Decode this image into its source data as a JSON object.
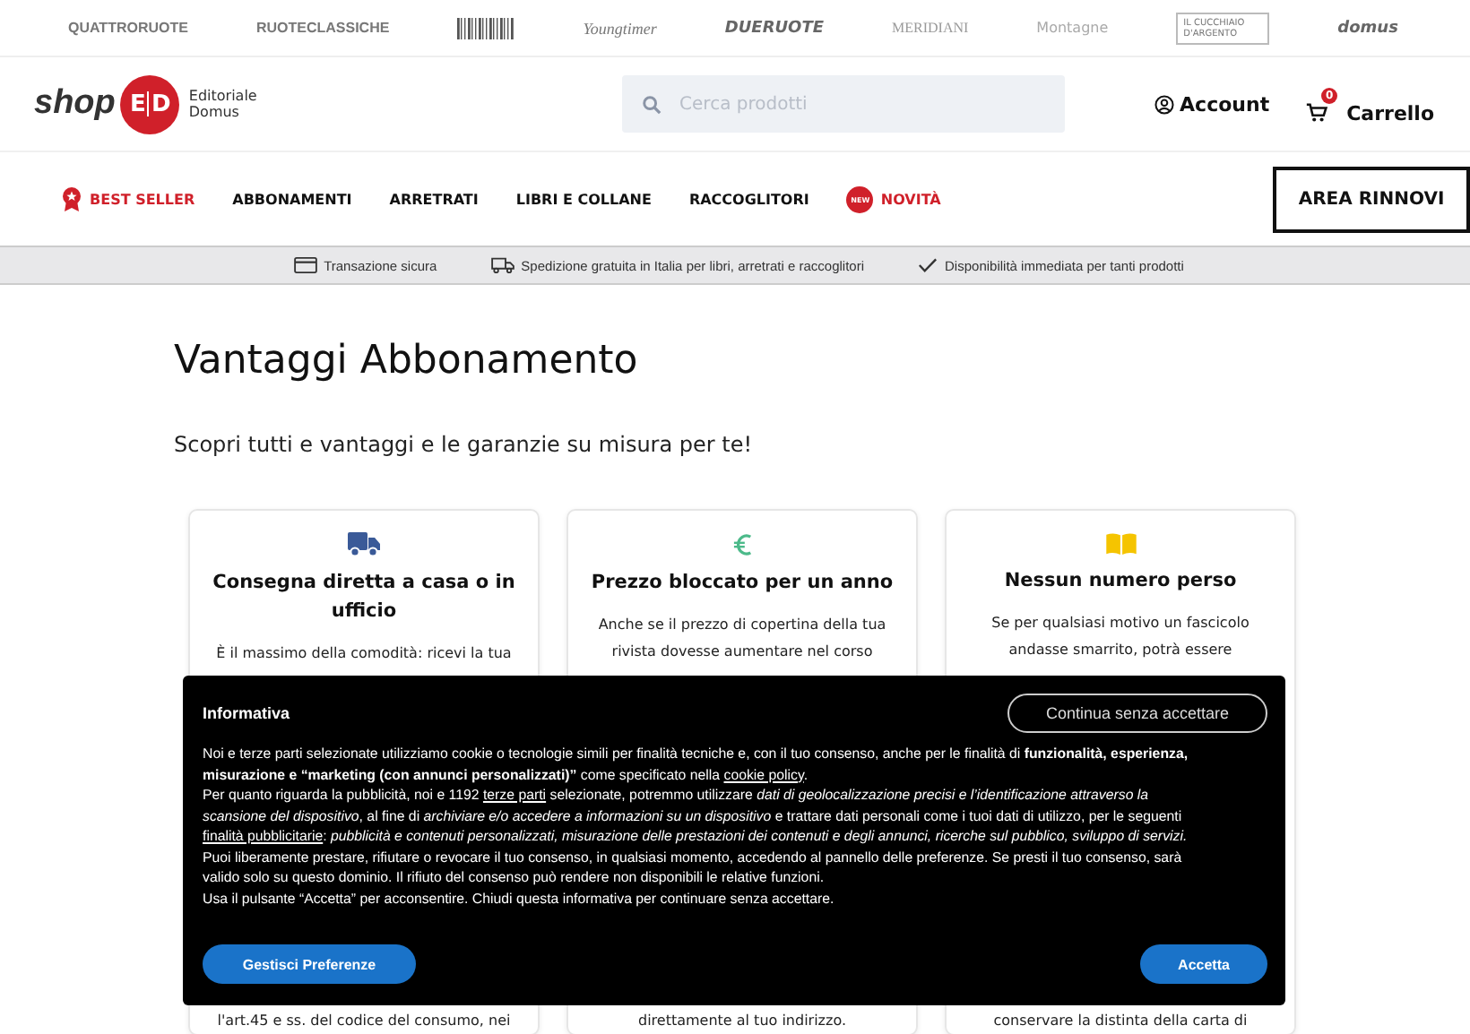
{
  "brands": [
    {
      "label": "QUATTRORUOTE",
      "kind": "caps"
    },
    {
      "label": "RUOTECLASSICHE",
      "kind": "caps"
    },
    {
      "kind": "barcode"
    },
    {
      "label": "Youngtimer",
      "kind": "script"
    },
    {
      "label": "DUERUOTE",
      "kind": "heavy"
    },
    {
      "label": "MERIDIANI",
      "kind": "serif"
    },
    {
      "label": "Montagne",
      "kind": "faded"
    },
    {
      "label": "IL CUCCHIAIO D'ARGENTO",
      "kind": "boxed"
    },
    {
      "label": "domus",
      "kind": "heavy"
    }
  ],
  "header": {
    "logo_shop": "shop",
    "logo_e": "E",
    "logo_d": "D",
    "logo_line1": "Editoriale",
    "logo_line2": "Domus",
    "search_placeholder": "Cerca prodotti",
    "account": "Account",
    "cart": "Carrello",
    "cart_count": "0"
  },
  "nav": {
    "items": [
      {
        "label": "BEST SELLER",
        "kind": "badge-star",
        "selected": false
      },
      {
        "label": "ABBONAMENTI",
        "kind": "plain",
        "selected": false
      },
      {
        "label": "ARRETRATI",
        "kind": "plain",
        "selected": false
      },
      {
        "label": "LIBRI E COLLANE",
        "kind": "plain",
        "selected": false
      },
      {
        "label": "RACCOGLITORI",
        "kind": "plain",
        "selected": false
      },
      {
        "label": "NOVITÀ",
        "kind": "badge-new",
        "selected": false
      }
    ],
    "new_badge": "NEW",
    "cta": "AREA RINNOVI"
  },
  "benefits_strip": [
    {
      "label": "Transazione sicura",
      "kind": "card"
    },
    {
      "label": "Spedizione gratuita in Italia per libri, arretrati e raccoglitori",
      "kind": "truck"
    },
    {
      "label": "Disponibilità immediata per tanti prodotti",
      "kind": "check"
    }
  ],
  "page": {
    "title": "Vantaggi Abbonamento",
    "subtitle": "Scopri tutti e vantaggi e le garanzie su misura per te!"
  },
  "cards": [
    {
      "kind": "truck",
      "title": "Consegna diretta a casa o in ufficio",
      "text_top": "È il massimo della comodità: ricevi la tua",
      "text_bottom": "l'art.45 e ss. del codice del consumo, nei"
    },
    {
      "kind": "euro",
      "title": "Prezzo bloccato per un anno",
      "text_top": "Anche se il prezzo di copertina della tua rivista dovesse aumentare nel corso",
      "text_bottom": "direttamente al tuo indirizzo."
    },
    {
      "kind": "book",
      "title": "Nessun numero perso",
      "text_top": "Se per qualsiasi motivo un fascicolo andasse smarrito, potrà essere",
      "text_bottom": "conservare la distinta della carta di"
    }
  ],
  "cookie_banner": {
    "title": "Informativa",
    "continue_button": "Continua senza accettare",
    "paragraphs": [
      [
        {
          "kind": "text",
          "text": "Noi e terze parti selezionate utilizziamo cookie o tecnologie simili per finalità tecniche e, con il tuo consenso, anche per le finalità di **funzionalità, esperienza, misurazione e “marketing (con annunci personalizzati)”** come specificato nella "
        },
        {
          "kind": "link",
          "text": "cookie policy"
        },
        {
          "kind": "text",
          "text": "."
        }
      ],
      [
        {
          "kind": "text",
          "text": "Per quanto riguarda la pubblicità, noi e 1192 "
        },
        {
          "kind": "link",
          "text": "terze parti"
        },
        {
          "kind": "text",
          "text": " selezionate, potremmo utilizzare *dati di geolocalizzazione precisi e l’identificazione attraverso la scansione del dispositivo*, al fine di *archiviare e/o accedere a informazioni su un dispositivo* e trattare dati personali come i tuoi dati di utilizzo, per le seguenti "
        },
        {
          "kind": "link",
          "text": "finalità pubblicitarie"
        },
        {
          "kind": "text",
          "text": ": *pubblicità e contenuti personalizzati, misurazione delle prestazioni dei contenuti e degli annunci, ricerche sul pubblico, sviluppo di servizi.*"
        }
      ],
      [
        {
          "kind": "text",
          "text": "Puoi liberamente prestare, rifiutare o revocare il tuo consenso, in qualsiasi momento, accedendo al pannello delle preferenze. Se presti il tuo consenso, sarà valido solo su questo dominio. Il rifiuto del consenso può rendere non disponibili le relative funzioni."
        }
      ],
      [
        {
          "kind": "text",
          "text": "Usa il pulsante “Accetta” per acconsentire. Chiudi questa informativa per continuare senza accettare."
        }
      ]
    ],
    "manage_button": "Gestisci Preferenze",
    "accept_button": "Accetta"
  }
}
